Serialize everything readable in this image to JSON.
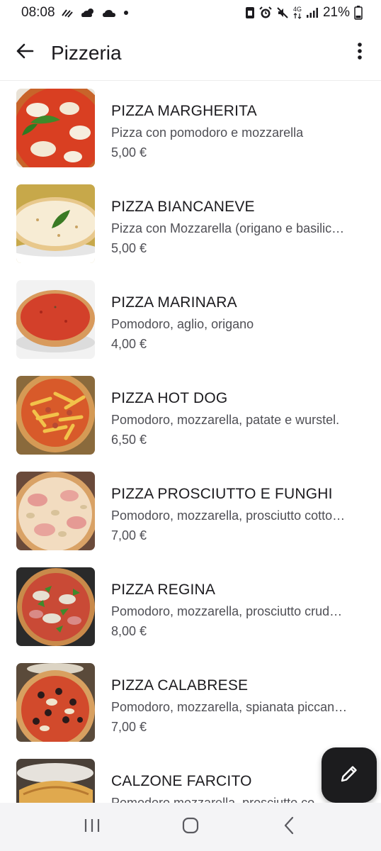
{
  "status_bar": {
    "time": "08:08",
    "network_type": "4G",
    "battery_percent": "21%",
    "icons_left": [
      "weather-icon",
      "cloud-sun-icon",
      "cloud-icon",
      "notification-dot-icon"
    ],
    "icons_right": [
      "sim-icon",
      "alarm-icon",
      "mute-icon",
      "network-arrows-icon",
      "signal-icon",
      "battery-icon"
    ]
  },
  "app_bar": {
    "title": "Pizzeria",
    "back_icon": "arrow-back-icon",
    "menu_icon": "more-vert-icon"
  },
  "items": [
    {
      "name": "PIZZA MARGHERITA",
      "description": "Pizza con pomodoro e mozzarella",
      "price": "5,00 €",
      "image": "margherita"
    },
    {
      "name": "PIZZA BIANCANEVE",
      "description": "Pizza con Mozzarella (origano e basilic…",
      "price": "5,00 €",
      "image": "biancaneve"
    },
    {
      "name": "PIZZA MARINARA",
      "description": "Pomodoro, aglio, origano",
      "price": "4,00 €",
      "image": "marinara"
    },
    {
      "name": "PIZZA HOT DOG",
      "description": "Pomodoro, mozzarella, patate e wurstel.",
      "price": "6,50 €",
      "image": "hotdog"
    },
    {
      "name": "PIZZA PROSCIUTTO E FUNGHI",
      "description": "Pomodoro, mozzarella, prosciutto cotto…",
      "price": "7,00 €",
      "image": "prosciutto"
    },
    {
      "name": "PIZZA REGINA",
      "description": "Pomodoro, mozzarella, prosciutto crud…",
      "price": "8,00 €",
      "image": "regina"
    },
    {
      "name": "PIZZA CALABRESE",
      "description": "Pomodoro, mozzarella, spianata piccan…",
      "price": "7,00 €",
      "image": "calabrese"
    },
    {
      "name": "CALZONE FARCITO",
      "description": "Pomodoro mozzarella, prosciutto co…",
      "price": "",
      "image": "calzone"
    }
  ],
  "fab": {
    "icon": "edit-pencil-icon"
  },
  "nav_bar": {
    "icons": [
      "recent-apps-icon",
      "home-icon",
      "back-icon"
    ]
  },
  "colors": {
    "background": "#ffffff",
    "text": "#1c1b1f",
    "secondary_text": "#4f4f55",
    "fab": "#1c1c1e",
    "nav_bar": "#f4f4f6"
  }
}
